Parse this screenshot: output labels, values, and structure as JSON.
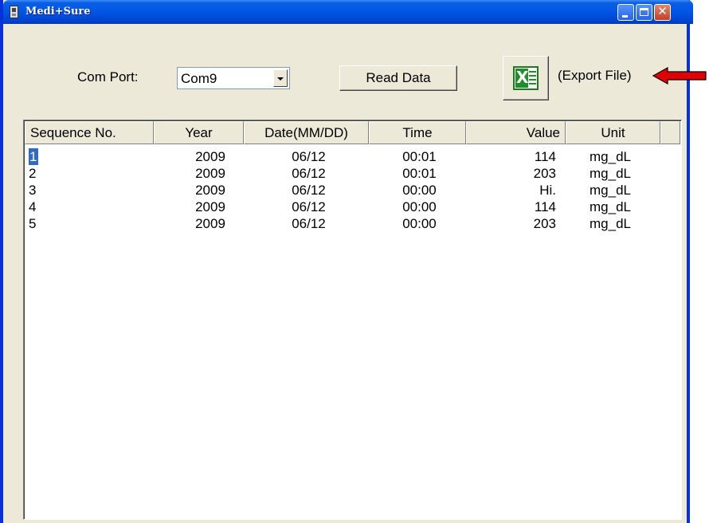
{
  "window": {
    "title": "Medi+Sure",
    "min_icon": "minimize-icon",
    "max_icon": "maximize-icon",
    "close_icon": "close-icon",
    "close_glyph": "✕"
  },
  "toolbar": {
    "com_port_label": "Com Port:",
    "com_port_value": "Com9",
    "read_button": "Read Data",
    "export_icon": "excel-icon",
    "export_icon_glyph": "X",
    "export_label": "(Export File)"
  },
  "table": {
    "columns": [
      "Sequence No.",
      "Year",
      "Date(MM/DD)",
      "Time",
      "Value",
      "Unit"
    ],
    "rows": [
      {
        "seq": "1",
        "year": "2009",
        "date": "06/12",
        "time": "00:01",
        "value": "114",
        "unit": "mg_dL"
      },
      {
        "seq": "2",
        "year": "2009",
        "date": "06/12",
        "time": "00:01",
        "value": "203",
        "unit": "mg_dL"
      },
      {
        "seq": "3",
        "year": "2009",
        "date": "06/12",
        "time": "00:00",
        "value": "Hi.",
        "unit": "mg_dL"
      },
      {
        "seq": "4",
        "year": "2009",
        "date": "06/12",
        "time": "00:00",
        "value": "114",
        "unit": "mg_dL"
      },
      {
        "seq": "5",
        "year": "2009",
        "date": "06/12",
        "time": "00:00",
        "value": "203",
        "unit": "mg_dL"
      }
    ],
    "selected_row": 1
  },
  "colors": {
    "titlebar": "#0055e5",
    "selection": "#316ac5",
    "excel_green": "#1f8f2a",
    "arrow": "#e00000"
  }
}
